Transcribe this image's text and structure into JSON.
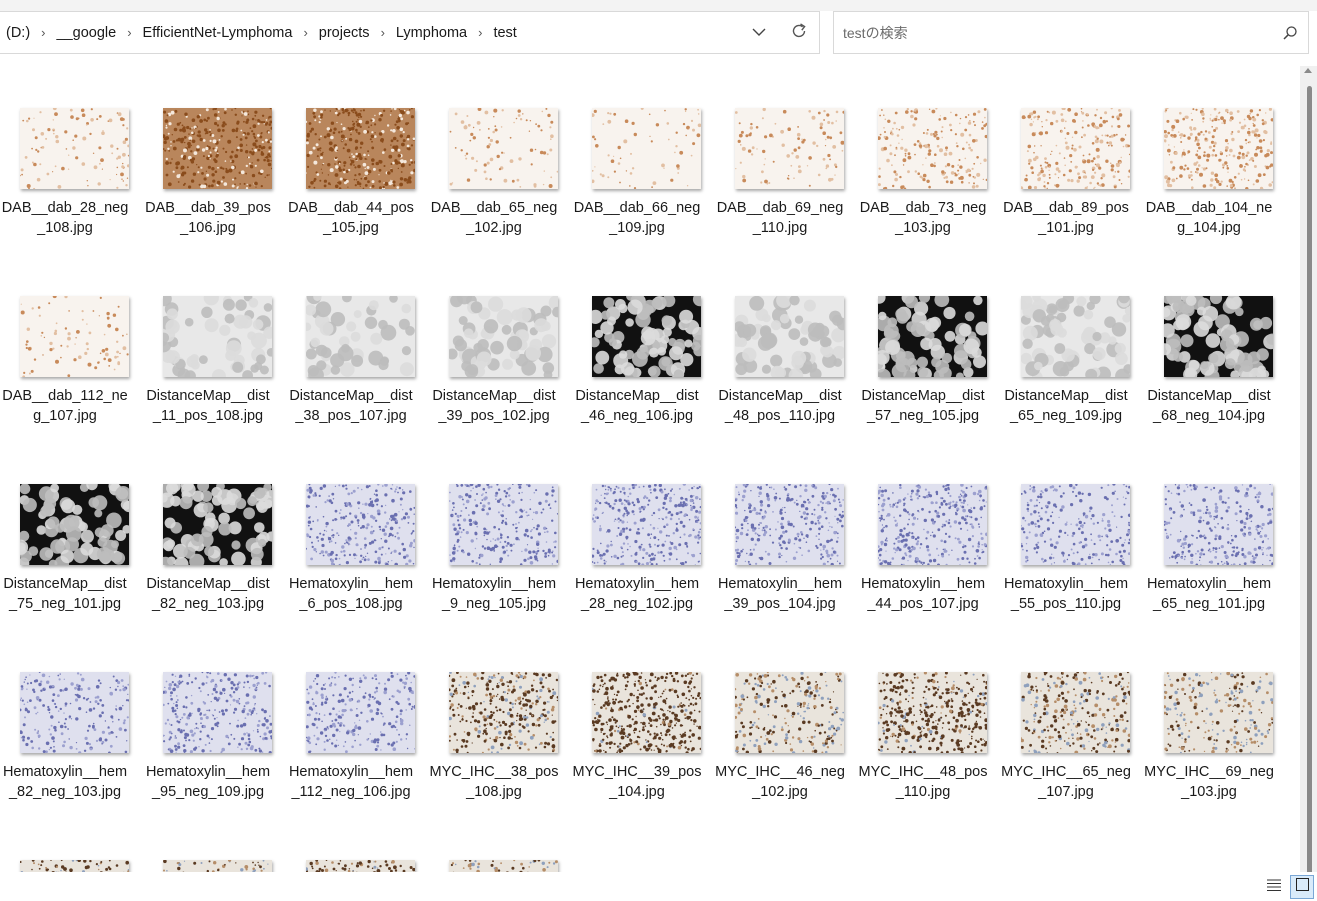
{
  "breadcrumb": [
    "(D:)",
    "__google",
    "EfficientNet-Lymphoma",
    "projects",
    "Lymphoma",
    "test"
  ],
  "search": {
    "placeholder": "testの検索"
  },
  "icons": {
    "dropdown": "chevron-down-icon",
    "refresh": "refresh-icon",
    "search": "search-icon",
    "details_view": "details-view-icon",
    "large_icons_view": "large-icons-view-icon"
  },
  "files": [
    {
      "name": "DAB__dab_28_neg_108.jpg",
      "type": "dab",
      "level": 0.15
    },
    {
      "name": "DAB__dab_39_pos_106.jpg",
      "type": "dab",
      "level": 0.9
    },
    {
      "name": "DAB__dab_44_pos_105.jpg",
      "type": "dab",
      "level": 0.95
    },
    {
      "name": "DAB__dab_65_neg_102.jpg",
      "type": "dab",
      "level": 0.1
    },
    {
      "name": "DAB__dab_66_neg_109.jpg",
      "type": "dab",
      "level": 0.03
    },
    {
      "name": "DAB__dab_69_neg_110.jpg",
      "type": "dab",
      "level": 0.12
    },
    {
      "name": "DAB__dab_73_neg_103.jpg",
      "type": "dab",
      "level": 0.45
    },
    {
      "name": "DAB__dab_89_pos_101.jpg",
      "type": "dab",
      "level": 0.55
    },
    {
      "name": "DAB__dab_104_neg_104.jpg",
      "type": "dab",
      "level": 0.7
    },
    {
      "name": "DAB__dab_112_neg_107.jpg",
      "type": "dab",
      "level": 0.08
    },
    {
      "name": "DistanceMap__dist_11_pos_108.jpg",
      "type": "dist",
      "level": 0.3
    },
    {
      "name": "DistanceMap__dist_38_pos_107.jpg",
      "type": "dist",
      "level": 0.15
    },
    {
      "name": "DistanceMap__dist_39_pos_102.jpg",
      "type": "dist",
      "level": 0.4
    },
    {
      "name": "DistanceMap__dist_46_neg_106.jpg",
      "type": "dist",
      "level": 0.6
    },
    {
      "name": "DistanceMap__dist_48_pos_110.jpg",
      "type": "dist",
      "level": 0.45
    },
    {
      "name": "DistanceMap__dist_57_neg_105.jpg",
      "type": "dist",
      "level": 0.55
    },
    {
      "name": "DistanceMap__dist_65_neg_109.jpg",
      "type": "dist",
      "level": 0.5
    },
    {
      "name": "DistanceMap__dist_68_neg_104.jpg",
      "type": "dist",
      "level": 0.65
    },
    {
      "name": "DistanceMap__dist_75_neg_101.jpg",
      "type": "dist",
      "level": 0.55
    },
    {
      "name": "DistanceMap__dist_82_neg_103.jpg",
      "type": "dist",
      "level": 0.6
    },
    {
      "name": "Hematoxylin__hem_6_pos_108.jpg",
      "type": "hem",
      "level": 0.55
    },
    {
      "name": "Hematoxylin__hem_9_neg_105.jpg",
      "type": "hem",
      "level": 0.5
    },
    {
      "name": "Hematoxylin__hem_28_neg_102.jpg",
      "type": "hem",
      "level": 0.75
    },
    {
      "name": "Hematoxylin__hem_39_pos_104.jpg",
      "type": "hem",
      "level": 0.6
    },
    {
      "name": "Hematoxylin__hem_44_pos_107.jpg",
      "type": "hem",
      "level": 0.7
    },
    {
      "name": "Hematoxylin__hem_55_pos_110.jpg",
      "type": "hem",
      "level": 0.35
    },
    {
      "name": "Hematoxylin__hem_65_neg_101.jpg",
      "type": "hem",
      "level": 0.55
    },
    {
      "name": "Hematoxylin__hem_82_neg_103.jpg",
      "type": "hem",
      "level": 0.25
    },
    {
      "name": "Hematoxylin__hem_95_neg_109.jpg",
      "type": "hem",
      "level": 0.6
    },
    {
      "name": "Hematoxylin__hem_112_neg_106.jpg",
      "type": "hem",
      "level": 0.4
    },
    {
      "name": "MYC_IHC__38_pos_108.jpg",
      "type": "myc",
      "level": 0.6
    },
    {
      "name": "MYC_IHC__39_pos_104.jpg",
      "type": "myc",
      "level": 0.9
    },
    {
      "name": "MYC_IHC__46_neg_102.jpg",
      "type": "myc",
      "level": 0.35
    },
    {
      "name": "MYC_IHC__48_pos_110.jpg",
      "type": "myc",
      "level": 0.8
    },
    {
      "name": "MYC_IHC__65_neg_107.jpg",
      "type": "myc",
      "level": 0.45
    },
    {
      "name": "MYC_IHC__69_neg_103.jpg",
      "type": "myc",
      "level": 0.3
    },
    {
      "name": "",
      "type": "myc",
      "level": 0.6
    },
    {
      "name": "",
      "type": "myc",
      "level": 0.4
    },
    {
      "name": "",
      "type": "myc",
      "level": 0.75
    },
    {
      "name": "",
      "type": "myc",
      "level": 0.35
    }
  ]
}
